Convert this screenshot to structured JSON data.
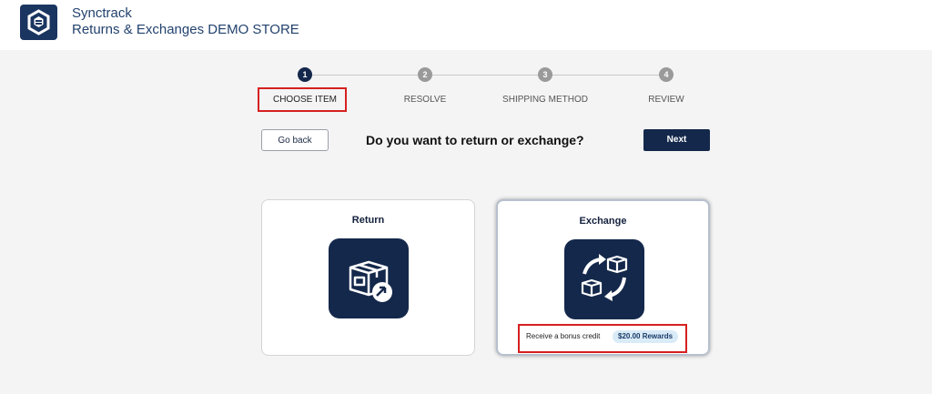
{
  "header": {
    "brand": "Synctrack",
    "store": "Returns & Exchanges DEMO STORE"
  },
  "steps": [
    {
      "number": "1",
      "label": "CHOOSE ITEM",
      "active": true
    },
    {
      "number": "2",
      "label": "RESOLVE",
      "active": false
    },
    {
      "number": "3",
      "label": "SHIPPING METHOD",
      "active": false
    },
    {
      "number": "4",
      "label": "REVIEW",
      "active": false
    }
  ],
  "actions": {
    "back_label": "Go back",
    "question": "Do you want to return or exchange?",
    "next_label": "Next"
  },
  "options": {
    "return": {
      "title": "Return",
      "icon": "box-return-icon"
    },
    "exchange": {
      "title": "Exchange",
      "icon": "box-exchange-icon",
      "bonus_text": "Receive a bonus credit",
      "bonus_badge": "$20.00 Rewards"
    }
  },
  "colors": {
    "primary": "#14284b",
    "highlight": "#d62020",
    "background": "#f4f4f5",
    "badge_bg": "#d9ebf7"
  }
}
